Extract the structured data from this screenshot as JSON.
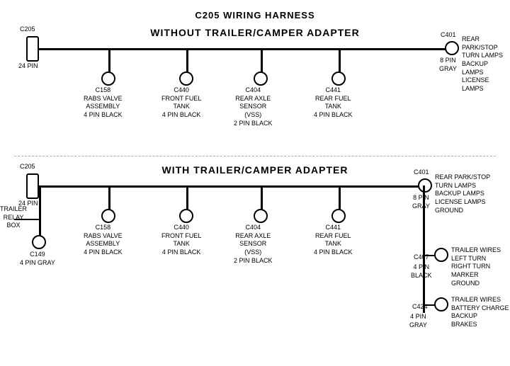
{
  "title": "C205 WIRING HARNESS",
  "top_section": {
    "label": "WITHOUT TRAILER/CAMPER ADAPTER",
    "left_connector": {
      "id": "C205",
      "pin_label": "24 PIN"
    },
    "right_connector": {
      "id": "C401",
      "pin_label": "8 PIN\nGRAY",
      "description": "REAR PARK/STOP\nTURN LAMPS\nBACKUP LAMPS\nLICENSE LAMPS"
    },
    "middle_connectors": [
      {
        "id": "C158",
        "desc": "RABS VALVE\nASSEMBLY\n4 PIN BLACK"
      },
      {
        "id": "C440",
        "desc": "FRONT FUEL\nTANK\n4 PIN BLACK"
      },
      {
        "id": "C404",
        "desc": "REAR AXLE\nSENSOR\n(VSS)\n2 PIN BLACK"
      },
      {
        "id": "C441",
        "desc": "REAR FUEL\nTANK\n4 PIN BLACK"
      }
    ]
  },
  "bottom_section": {
    "label": "WITH TRAILER/CAMPER ADAPTER",
    "left_connector": {
      "id": "C205",
      "pin_label": "24 PIN"
    },
    "right_connector": {
      "id": "C401",
      "pin_label": "8 PIN\nGRAY",
      "description": "REAR PARK/STOP\nTURN LAMPS\nBACKUP LAMPS\nLICENSE LAMPS\nGROUND"
    },
    "extra_left": {
      "label": "TRAILER\nRELAY\nBOX",
      "id": "C149",
      "pin_label": "4 PIN GRAY"
    },
    "middle_connectors": [
      {
        "id": "C158",
        "desc": "RABS VALVE\nASSEMBLY\n4 PIN BLACK"
      },
      {
        "id": "C440",
        "desc": "FRONT FUEL\nTANK\n4 PIN BLACK"
      },
      {
        "id": "C404",
        "desc": "REAR AXLE\nSENSOR\n(VSS)\n2 PIN BLACK"
      },
      {
        "id": "C441",
        "desc": "REAR FUEL\nTANK\n4 PIN BLACK"
      }
    ],
    "right_extra": [
      {
        "id": "C407",
        "pin_label": "4 PIN\nBLACK",
        "description": "TRAILER WIRES\nLEFT TURN\nRIGHT TURN\nMARKER\nGROUND"
      },
      {
        "id": "C424",
        "pin_label": "4 PIN\nGRAY",
        "description": "TRAILER WIRES\nBATTERY CHARGE\nBACKUP\nBRAKES"
      }
    ]
  }
}
